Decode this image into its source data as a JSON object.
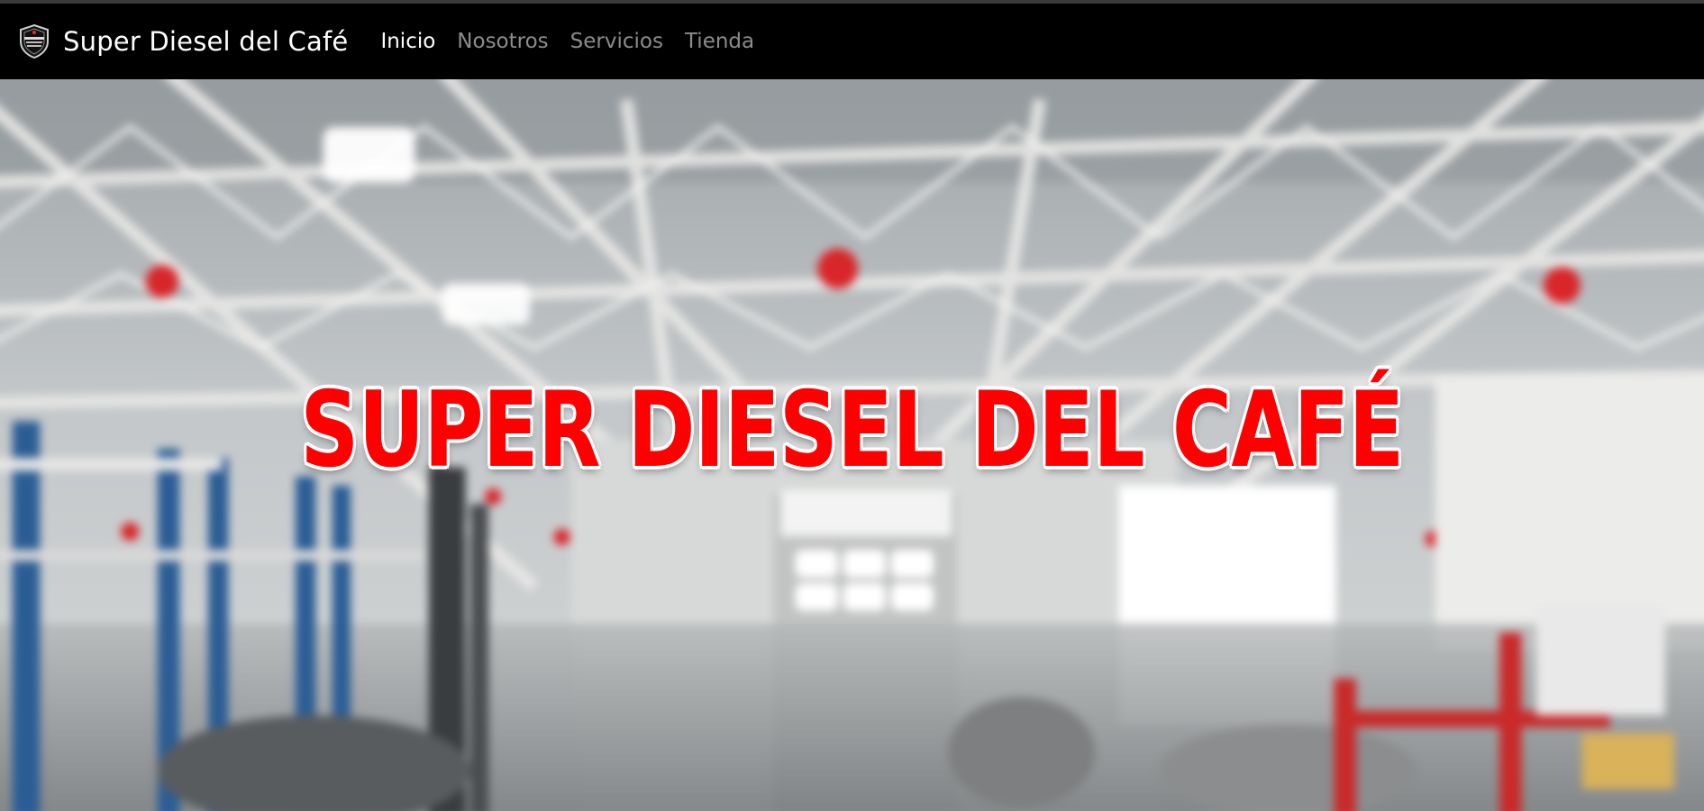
{
  "navbar": {
    "brand": {
      "logo_icon": "super-diesel-shield-logo",
      "name": "Super Diesel del Café"
    },
    "links": [
      {
        "label": "Inicio",
        "active": true
      },
      {
        "label": "Nosotros",
        "active": false
      },
      {
        "label": "Servicios",
        "active": false
      },
      {
        "label": "Tienda",
        "active": false
      }
    ]
  },
  "hero": {
    "title": "SUPER DIESEL DEL CAFÉ",
    "background": "blurred-garage-workshop-photo",
    "title_color": "#ff0000",
    "title_outline_color": "#ffffff"
  }
}
